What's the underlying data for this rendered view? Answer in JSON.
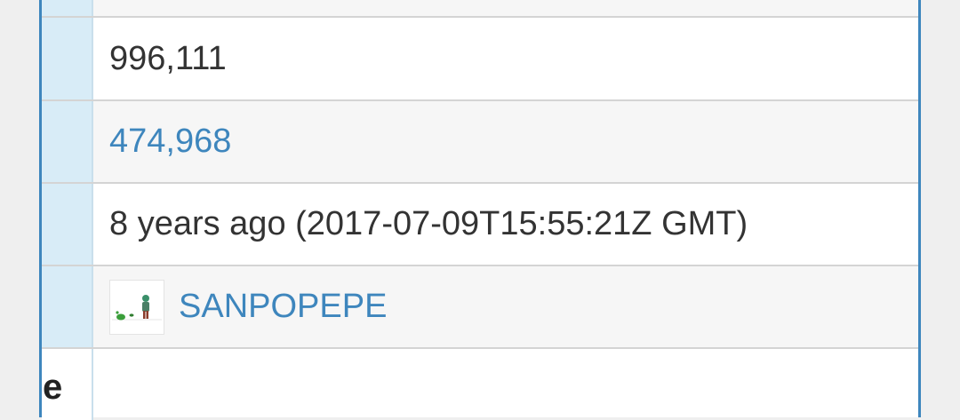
{
  "rows": {
    "views": "996,111",
    "likes": "474,968",
    "uploaded": "8 years ago (2017-07-09T15:55:21Z GMT)",
    "author": "SANPOPEPE",
    "partial_label": "e"
  },
  "colors": {
    "link": "#3e86bd",
    "label_bg": "#d8ecf7",
    "frame": "#3e86bd"
  }
}
